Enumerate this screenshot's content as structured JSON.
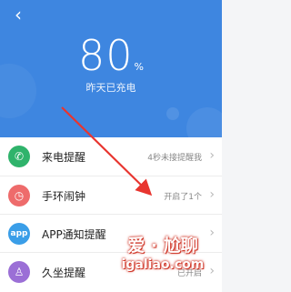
{
  "header": {
    "battery_value": "80",
    "battery_unit": "%",
    "charge_status": "昨天已充电",
    "color": "#3e86e0"
  },
  "list": {
    "items": [
      {
        "label": "来电提醒",
        "status": "4秒未接提醒我",
        "icon": "phone-icon",
        "icon_glyph": "✆",
        "color": "#2fb36b"
      },
      {
        "label": "手环闹钟",
        "status": "开启了1个",
        "icon": "alarm-clock-icon",
        "icon_glyph": "◷",
        "color": "#ee6b6b"
      },
      {
        "label": "APP通知提醒",
        "status": "",
        "icon": "app-icon",
        "icon_glyph": "app",
        "color": "#3a9ee8"
      },
      {
        "label": "久坐提醒",
        "status": "已开启",
        "icon": "sedentary-icon",
        "icon_glyph": "♙",
        "color": "#9b6fd6"
      }
    ]
  },
  "watermark": {
    "title": "爱 · 尬聊",
    "url": "igaliao.com",
    "color": "#d0392b"
  }
}
